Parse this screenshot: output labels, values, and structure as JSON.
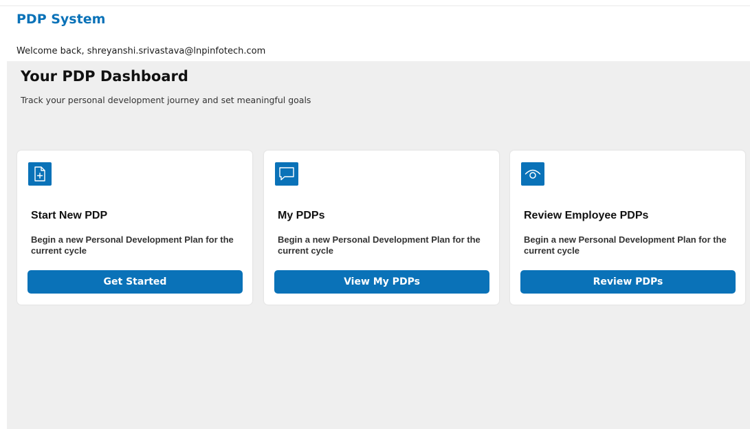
{
  "header": {
    "app_title": "PDP System",
    "welcome": "Welcome back, shreyanshi.srivastava@lnpinfotech.com"
  },
  "dashboard": {
    "title": "Your PDP Dashboard",
    "subtitle": "Track your personal development journey and set meaningful goals"
  },
  "cards": [
    {
      "icon": "add-document-icon",
      "title": "Start New PDP",
      "description": "Begin a new Personal Development Plan for the current cycle",
      "button": "Get Started"
    },
    {
      "icon": "chat-bubble-icon",
      "title": "My PDPs",
      "description": "Begin a new Personal Development Plan for the current cycle",
      "button": "View My PDPs"
    },
    {
      "icon": "eye-icon",
      "title": "Review Employee PDPs",
      "description": "Begin a new Personal Development Plan for the current cycle",
      "button": "Review PDPs"
    }
  ],
  "colors": {
    "brand": "#0a72b8",
    "page_background": "#efefef",
    "card_background": "#ffffff"
  }
}
